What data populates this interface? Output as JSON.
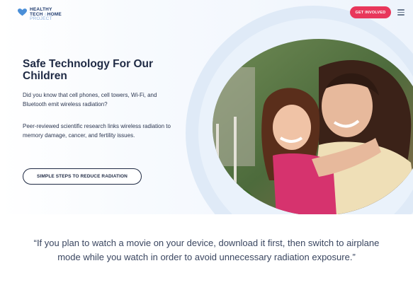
{
  "header": {
    "logo_line1": "HEALTHY",
    "logo_line2_a": "TECH",
    "logo_line2_b": "HOME",
    "logo_line3": "PROJECT",
    "get_involved_label": "GET INVOLVED",
    "menu_icon": "hamburger-menu-icon"
  },
  "hero": {
    "title": "Safe Technology For Our Children",
    "paragraph1": "Did you know that cell phones, cell towers, Wi-Fi, and Bluetooth emit wireless radiation?",
    "paragraph2": "Peer-reviewed scientific research links wireless radiation to memory damage, cancer, and fertility issues.",
    "cta_label": "SIMPLE STEPS TO REDUCE RADIATION"
  },
  "quote": {
    "text": "“If you plan to watch a movie on your device, download it first, then switch to airplane mode while you watch in order to avoid unnecessary radiation exposure.”"
  },
  "colors": {
    "accent": "#e8375b",
    "navy": "#1f2a44",
    "logo_blue": "#8fb3e0"
  }
}
